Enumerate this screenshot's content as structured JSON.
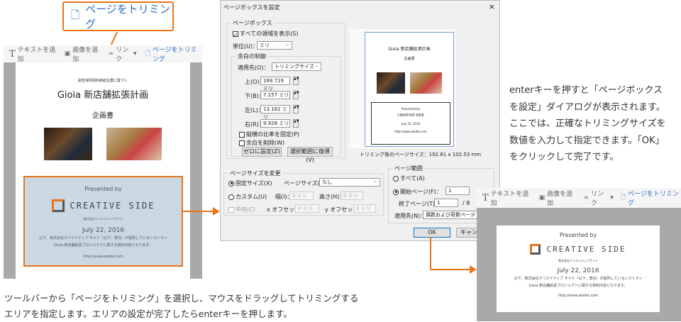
{
  "callout": {
    "label": "ページをトリミング",
    "icon": "crop-page-icon"
  },
  "toolbar": {
    "add_text": "テキストを追加",
    "add_image": "画像を追加",
    "link": "リンク",
    "crop": "ページをトリミング"
  },
  "document": {
    "subtitle": "秘密保持契約締結企業に置づく",
    "title": "Gioia 新店舗拡張計画",
    "heading": "企画書",
    "presented_by": "Presented by",
    "company": "CREATIVE SIDE",
    "company_jp": "株式会社クリエイティブサイド",
    "date": "July 22, 2016",
    "body1": "以下、株式会社クリエイティブ サイド（以下、弊社）が提供しているレストラン",
    "body2": "Gioia 新店舗拡張プロジェクトに関する契約内容となります。",
    "url": "http://www.adobe.com"
  },
  "dialog": {
    "title": "ページボックスを設定",
    "close": "×",
    "pagebox": {
      "group": "ページボックス",
      "show_all": "すべての領域を表示(S)",
      "unit_label": "単位(U)：",
      "unit_value": "ミリ"
    },
    "margins": {
      "group": "余白の制御",
      "apply_label": "適用先(O)：",
      "apply_value": "トリミングサイズ",
      "top_label": "上(O)：",
      "top": "169.719 ミリ",
      "bottom_label": "下(B)：",
      "bottom": "7.157 ミリ",
      "left_label": "左(L)：",
      "left": "13.162 ミリ",
      "right_label": "右(R)：",
      "right": "9.928 ミリ",
      "constrain": "縦横の比率を固定(P)",
      "remove_white": "余白を削除(W)",
      "set_zero": "ゼロに設定(Z)",
      "revert": "選択範囲に復帰(V)"
    },
    "preview_size": "トリミング後のページサイズ：192.81 x 102.53 mm",
    "pagesize": {
      "group": "ページサイズを変更",
      "fixed": "固定サイズ(X)",
      "size_label": "ページサイズ(Q)：",
      "size_value": "なし",
      "custom": "カスタム(U)",
      "width_label": "幅(I)：",
      "width": "0 ミリ",
      "height_label": "高さ(H)：",
      "height": "0 ミリ",
      "center": "中央(C)",
      "xoff_label": "x オフセット：",
      "xoff": "0 ミリ",
      "yoff_label": "y オフセット：",
      "yoff": "0 ミリ"
    },
    "range": {
      "group": "ページ範囲",
      "all": "すべて(A)",
      "from_label": "開始ページ(F)：",
      "from": "1",
      "to_label": "終了ページ(T)：",
      "to": "1",
      "of": "/ 8",
      "apply_label": "適用先(N)：",
      "apply_value": "偶数および奇数ページ"
    },
    "ok": "OK",
    "cancel": "キャンセル"
  },
  "right_text": [
    "enterキーを押すと「ページボックス",
    "を設定」ダイアログが表示されます。",
    "ここでは、正確なトリミングサイズを",
    "数値を入力して指定できます。「OK」",
    "をクリックして完了です。"
  ],
  "caption": [
    "ツールバーから「ページをトリミング」を選択し、マウスをドラッグしてトリミングする",
    "エリアを指定します。エリアの設定が完了したらenterキーを押します。"
  ],
  "colors": {
    "accent": "#e8751a",
    "link_blue": "#2f6fc4"
  }
}
